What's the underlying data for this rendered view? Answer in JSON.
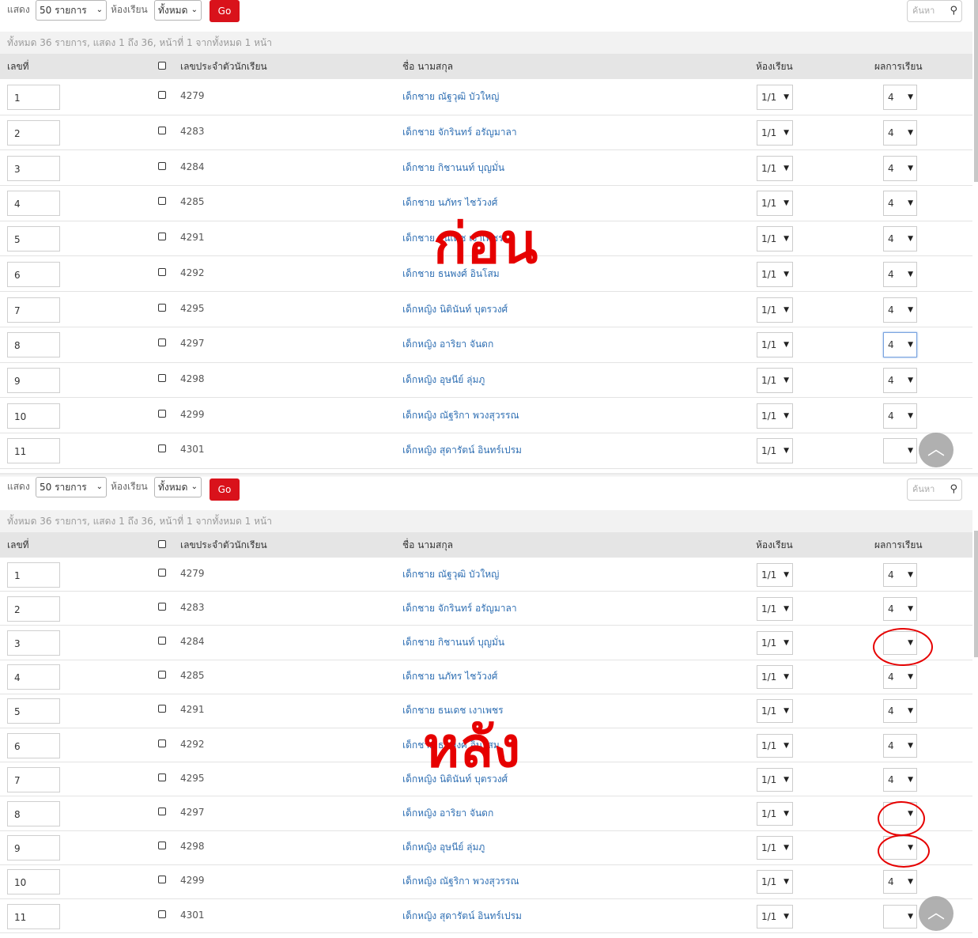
{
  "toolbar": {
    "show_label": "แสดง",
    "page_size": "50 รายการ",
    "room_label": "ห้องเรียน",
    "room_filter": "ทั้งหมด",
    "go_label": "Go",
    "search_placeholder": "ค้นหา"
  },
  "info_text": "ทั้งหมด 36 รายการ, แสดง 1 ถึง 36, หน้าที่ 1 จากทั้งหมด 1 หน้า",
  "columns": {
    "seq": "เลขที่",
    "student_id": "เลขประจำตัวนักเรียน",
    "name": "ชื่อ นามสกุล",
    "room": "ห้องเรียน",
    "result": "ผลการเรียน"
  },
  "students": [
    {
      "seq": "1",
      "id": "4279",
      "name": "เด็กชาย ณัฐวุฒิ บัวใหญ่",
      "room": "1/1"
    },
    {
      "seq": "2",
      "id": "4283",
      "name": "เด็กชาย จักรินทร์ อรัญมาลา",
      "room": "1/1"
    },
    {
      "seq": "3",
      "id": "4284",
      "name": "เด็กชาย กิชานนท์ บุญมั่น",
      "room": "1/1"
    },
    {
      "seq": "4",
      "id": "4285",
      "name": "เด็กชาย นภัทร ไชว้วงศ์",
      "room": "1/1"
    },
    {
      "seq": "5",
      "id": "4291",
      "name": "เด็กชาย ธนเดช เงาเพชร",
      "room": "1/1"
    },
    {
      "seq": "6",
      "id": "4292",
      "name": "เด็กชาย ธนพงศ์ อินโสม",
      "room": "1/1"
    },
    {
      "seq": "7",
      "id": "4295",
      "name": "เด็กหญิง นิตินันท์ บุตรวงศ์",
      "room": "1/1"
    },
    {
      "seq": "8",
      "id": "4297",
      "name": "เด็กหญิง อาริยา จันดก",
      "room": "1/1"
    },
    {
      "seq": "9",
      "id": "4298",
      "name": "เด็กหญิง อุษนีย์ ลุ่มภู",
      "room": "1/1"
    },
    {
      "seq": "10",
      "id": "4299",
      "name": "เด็กหญิง ณัฐริกา พวงสุวรรณ",
      "room": "1/1"
    },
    {
      "seq": "11",
      "id": "4301",
      "name": "เด็กหญิง สุดารัตน์ อินทร์เปรม",
      "room": "1/1"
    }
  ],
  "grades_before": [
    "4",
    "4",
    "4",
    "4",
    "4",
    "4",
    "4",
    "4",
    "4",
    "4",
    ""
  ],
  "grades_after": [
    "4",
    "4",
    "",
    "4",
    "4",
    "4",
    "4",
    "",
    "",
    "4",
    ""
  ],
  "overlay": {
    "before": "ก่อน",
    "after": "หลัง",
    "color": "#e60000"
  },
  "colors": {
    "go_button": "#d9121b",
    "link": "#2f6fb3"
  }
}
